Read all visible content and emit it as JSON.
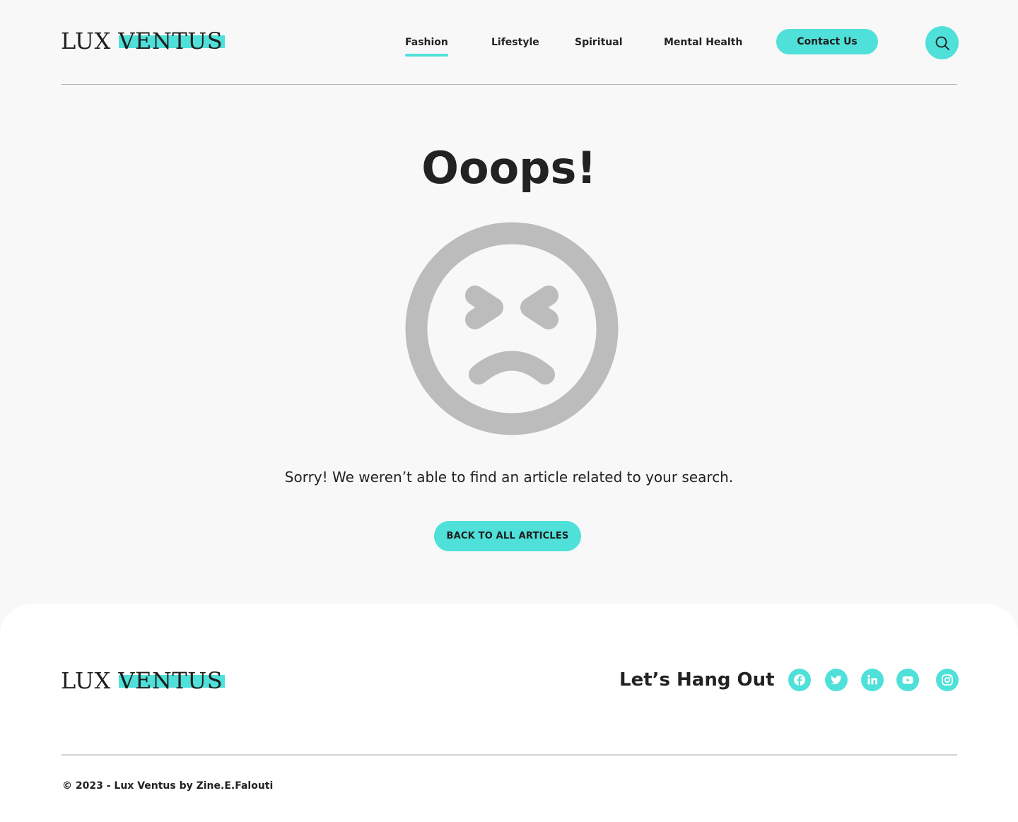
{
  "brand": {
    "name": "LUX VENTUS",
    "accent_color": "#4fe0d9"
  },
  "header": {
    "nav": [
      {
        "label": "Fashion",
        "active": true
      },
      {
        "label": "Lifestyle",
        "active": false
      },
      {
        "label": "Spiritual",
        "active": false
      },
      {
        "label": "Mental Health",
        "active": false
      }
    ],
    "contact_label": "Contact Us",
    "search_icon": "search-icon"
  },
  "main": {
    "headline": "Ooops!",
    "illustration": "sad-face-icon",
    "message": "Sorry! We weren’t able to find an article related to your search.",
    "back_button_label": "BACK TO ALL ARTICLES"
  },
  "footer": {
    "tagline": "Let’s Hang Out",
    "social": [
      {
        "name": "facebook-icon"
      },
      {
        "name": "twitter-icon"
      },
      {
        "name": "linkedin-icon"
      },
      {
        "name": "youtube-icon"
      },
      {
        "name": "instagram-icon"
      }
    ],
    "copyright": "© 2023 - Lux Ventus by Zine.E.Falouti"
  },
  "colors": {
    "background": "#f8f8f8",
    "footer_background": "#ffffff",
    "text": "#222222",
    "illustration_gray": "#bcbcbc"
  }
}
